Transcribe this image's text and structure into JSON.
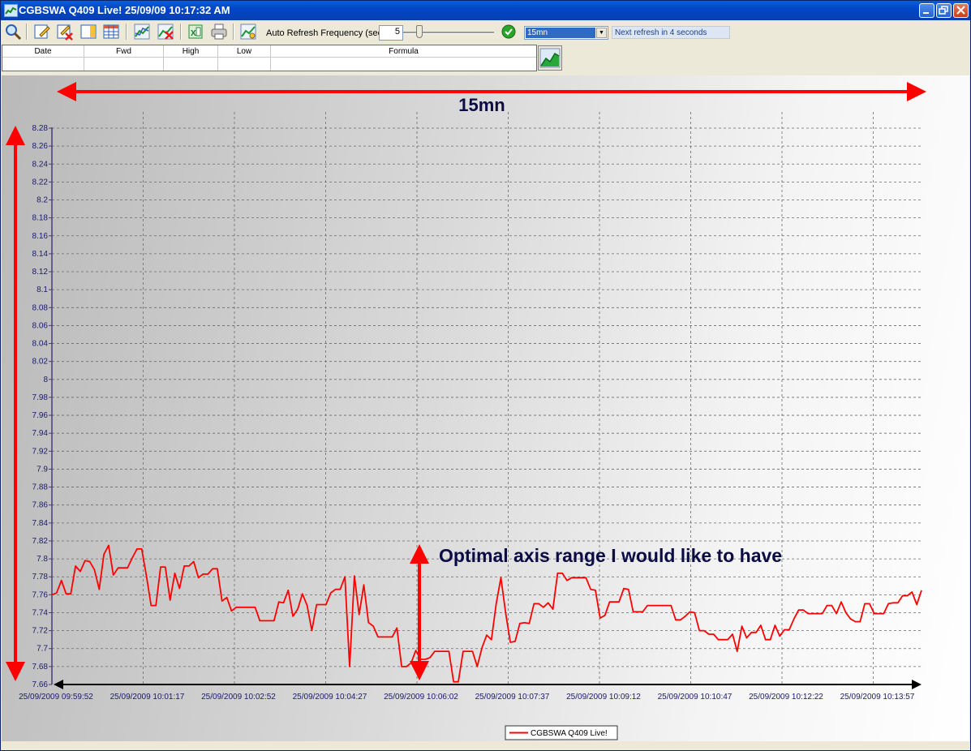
{
  "window": {
    "title": "CGBSWA Q409 Live! 25/09/09 10:17:32 AM",
    "title_color": "#ffffff",
    "titlebar_color": "#0a46c8"
  },
  "toolbar": {
    "icons": [
      "zoom-icon",
      "edit-icon",
      "edit-delete-icon",
      "panel-icon",
      "grid-icon",
      "chart-icon",
      "chart-delete-icon",
      "excel-export-icon",
      "print-icon",
      "chart-settings-icon"
    ],
    "refresh_label": "Auto Refresh Frequency (sec) :",
    "refresh_value": "5",
    "range_selected": "15mn",
    "next_refresh": "Next refresh in 4 seconds"
  },
  "table": {
    "columns": [
      "Date",
      "Fwd",
      "High",
      "Low",
      "Formula"
    ]
  },
  "annotations": {
    "top_label": "15mn",
    "middle_label": "Optimal axis range I would like to have",
    "arrow_color": "#ff0000",
    "text_color": "#0b0b45"
  },
  "chart_data": {
    "type": "line",
    "ylim": [
      7.66,
      8.28
    ],
    "y_ticks": [
      "8.28",
      "8.26",
      "8.24",
      "8.22",
      "8.2",
      "8.18",
      "8.16",
      "8.14",
      "8.12",
      "8.1",
      "8.08",
      "8.06",
      "8.04",
      "8.02",
      "8",
      "7.98",
      "7.96",
      "7.94",
      "7.92",
      "7.9",
      "7.88",
      "7.86",
      "7.84",
      "7.82",
      "7.8",
      "7.78",
      "7.76",
      "7.74",
      "7.72",
      "7.7",
      "7.68",
      "7.66"
    ],
    "x_ticks": [
      "25/09/2009 09:59:52",
      "25/09/2009 10:01:17",
      "25/09/2009 10:02:52",
      "25/09/2009 10:04:27",
      "25/09/2009 10:06:02",
      "25/09/2009 10:07:37",
      "25/09/2009 10:09:12",
      "25/09/2009 10:10:47",
      "25/09/2009 10:12:22",
      "25/09/2009 10:13:57"
    ],
    "grid": true,
    "legend_position": "bottom-center",
    "series": [
      {
        "name": "CGBSWA Q409 Live!",
        "color": "#ff0000",
        "values": [
          7.76,
          7.762,
          7.776,
          7.761,
          7.761,
          7.792,
          7.786,
          7.798,
          7.797,
          7.788,
          7.766,
          7.805,
          7.815,
          7.782,
          7.79,
          7.79,
          7.79,
          7.801,
          7.811,
          7.811,
          7.781,
          7.748,
          7.748,
          7.791,
          7.791,
          7.754,
          7.784,
          7.767,
          7.792,
          7.792,
          7.797,
          7.779,
          7.783,
          7.783,
          7.789,
          7.789,
          7.753,
          7.757,
          7.742,
          7.746,
          7.746,
          7.746,
          7.746,
          7.746,
          7.731,
          7.731,
          7.731,
          7.731,
          7.752,
          7.751,
          7.765,
          7.736,
          7.744,
          7.761,
          7.748,
          7.72,
          7.749,
          7.749,
          7.749,
          7.762,
          7.766,
          7.766,
          7.78,
          7.68,
          7.781,
          7.738,
          7.771,
          7.729,
          7.725,
          7.713,
          7.713,
          7.713,
          7.713,
          7.723,
          7.68,
          7.68,
          7.684,
          7.698,
          7.688,
          7.688,
          7.69,
          7.697,
          7.697,
          7.697,
          7.697,
          7.663,
          7.663,
          7.697,
          7.697,
          7.697,
          7.68,
          7.701,
          7.715,
          7.71,
          7.75,
          7.779,
          7.74,
          7.707,
          7.708,
          7.728,
          7.729,
          7.728,
          7.75,
          7.75,
          7.746,
          7.751,
          7.744,
          7.784,
          7.784,
          7.776,
          7.779,
          7.779,
          7.779,
          7.779,
          7.766,
          7.765,
          7.734,
          7.737,
          7.752,
          7.752,
          7.752,
          7.767,
          7.766,
          7.741,
          7.741,
          7.741,
          7.748,
          7.748,
          7.748,
          7.748,
          7.748,
          7.748,
          7.732,
          7.732,
          7.736,
          7.741,
          7.74,
          7.72,
          7.72,
          7.716,
          7.716,
          7.71,
          7.71,
          7.71,
          7.716,
          7.697,
          7.725,
          7.712,
          7.718,
          7.718,
          7.726,
          7.71,
          7.71,
          7.726,
          7.714,
          7.721,
          7.721,
          7.733,
          7.743,
          7.743,
          7.739,
          7.739,
          7.739,
          7.739,
          7.748,
          7.748,
          7.739,
          7.752,
          7.74,
          7.733,
          7.73,
          7.73,
          7.75,
          7.75,
          7.739,
          7.739,
          7.739,
          7.75,
          7.751,
          7.751,
          7.759,
          7.759,
          7.763,
          7.749,
          7.765
        ]
      }
    ]
  }
}
